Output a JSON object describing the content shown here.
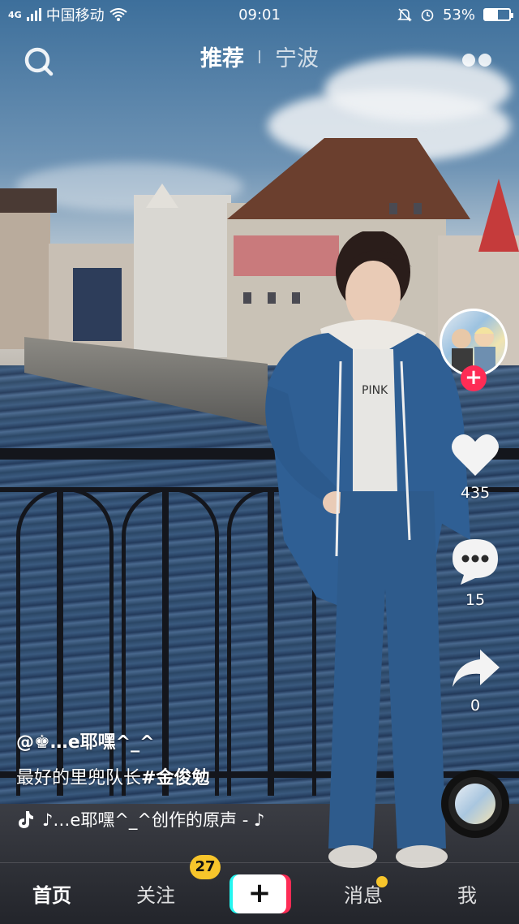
{
  "status_bar": {
    "network": "4G",
    "carrier": "中国移动",
    "time": "09:01",
    "battery_percent": "53%",
    "battery_level": 0.53
  },
  "top_nav": {
    "tabs": [
      {
        "label": "推荐",
        "active": true
      },
      {
        "label": "宁波",
        "active": false
      }
    ],
    "icons": [
      "search-icon",
      "more-icon"
    ]
  },
  "side_actions": {
    "follow_symbol": "+",
    "like_count": "435",
    "comment_count": "15",
    "share_count": "0",
    "icons": [
      "heart-icon",
      "comment-icon",
      "share-icon",
      "music-disc-icon"
    ]
  },
  "caption": {
    "author": "@♚…e耶嘿^_^",
    "description_text": "最好的里兜队长",
    "hashtag": "#金俊勉",
    "music": "♪…e耶嘿^_^创作的原声 - ♪"
  },
  "tab_bar": {
    "items": [
      {
        "label": "首页",
        "active": true
      },
      {
        "label": "关注",
        "badge": "27"
      },
      {
        "label": "+",
        "type": "create"
      },
      {
        "label": "消息",
        "dot": true
      },
      {
        "label": "我"
      }
    ]
  },
  "colors": {
    "accent_red": "#fe2c55",
    "accent_cyan": "#24f6f0",
    "badge_yellow": "#f7c52b"
  }
}
